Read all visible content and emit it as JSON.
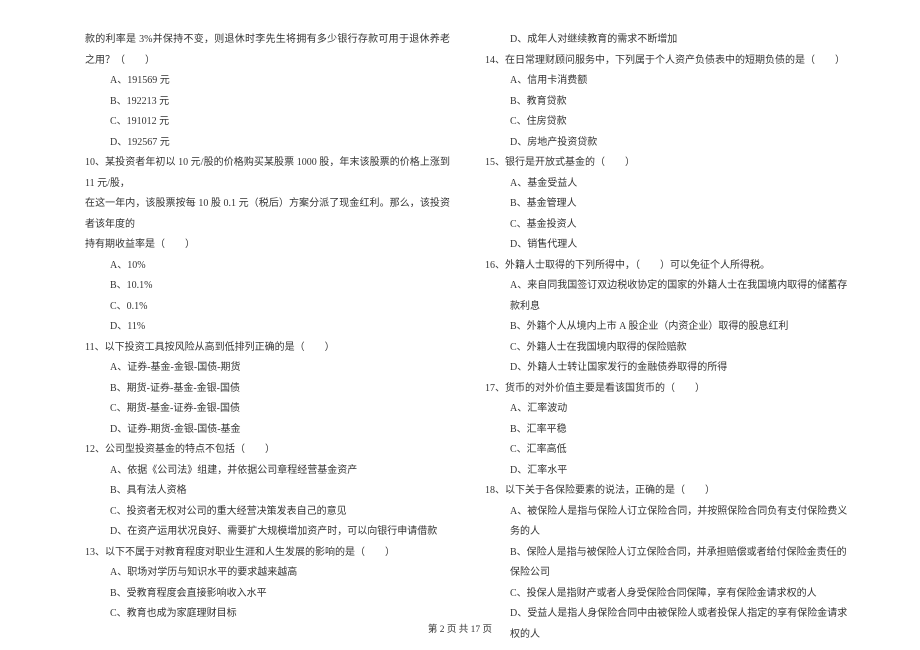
{
  "left": {
    "q9_tail": "款的利率是 3%并保持不变，则退休时李先生将拥有多少银行存款可用于退休养老之用？（　　）",
    "q9_opts": [
      "A、191569 元",
      "B、192213 元",
      "C、191012 元",
      "D、192567 元"
    ],
    "q10_stem_l1": "10、某投资者年初以 10 元/股的价格购买某股票 1000 股，年末该股票的价格上涨到 11 元/股，",
    "q10_stem_l2": "在这一年内，该股票按每 10 股 0.1 元（税后）方案分派了现金红利。那么，该投资者该年度的",
    "q10_stem_l3": "持有期收益率是（　　）",
    "q10_opts": [
      "A、10%",
      "B、10.1%",
      "C、0.1%",
      "D、11%"
    ],
    "q11_stem": "11、以下投资工具按风险从高到低排列正确的是（　　）",
    "q11_opts": [
      "A、证券-基金-金银-国债-期货",
      "B、期货-证券-基金-金银-国债",
      "C、期货-基金-证券-金银-国债",
      "D、证券-期货-金银-国债-基金"
    ],
    "q12_stem": "12、公司型投资基金的特点不包括（　　）",
    "q12_opts": [
      "A、依据《公司法》组建，并依据公司章程经营基金资产",
      "B、具有法人资格",
      "C、投资者无权对公司的重大经营决策发表自己的意见",
      "D、在资产运用状况良好、需要扩大规模增加资产时，可以向银行申请借款"
    ],
    "q13_stem": "13、以下不属于对教育程度对职业生涯和人生发展的影响的是（　　）",
    "q13_opts": [
      "A、职场对学历与知识水平的要求越来越高",
      "B、受教育程度会直接影响收入水平",
      "C、教育也成为家庭理财目标"
    ]
  },
  "right": {
    "q13_optD": "D、成年人对继续教育的需求不断增加",
    "q14_stem": "14、在日常理财顾问服务中，下列属于个人资产负债表中的短期负债的是（　　）",
    "q14_opts": [
      "A、信用卡消费额",
      "B、教育贷款",
      "C、住房贷款",
      "D、房地产投资贷款"
    ],
    "q15_stem": "15、银行是开放式基金的（　　）",
    "q15_opts": [
      "A、基金受益人",
      "B、基金管理人",
      "C、基金投资人",
      "D、销售代理人"
    ],
    "q16_stem": "16、外籍人士取得的下列所得中，（　　）可以免征个人所得税。",
    "q16_opts": [
      "A、来自同我国签订双边税收协定的国家的外籍人士在我国境内取得的储蓄存款利息",
      "B、外籍个人从境内上市 A 股企业（内资企业）取得的股息红利",
      "C、外籍人士在我国境内取得的保险赔款",
      "D、外籍人士转让国家发行的金融债券取得的所得"
    ],
    "q17_stem": "17、货币的对外价值主要是看该国货币的（　　）",
    "q17_opts": [
      "A、汇率波动",
      "B、汇率平稳",
      "C、汇率高低",
      "D、汇率水平"
    ],
    "q18_stem": "18、以下关于各保险要素的说法，正确的是（　　）",
    "q18_opts": [
      "A、被保险人是指与保险人订立保险合同，并按照保险合同负有支付保险费义务的人",
      "B、保险人是指与被保险人订立保险合同，并承担赔偿或者给付保险金责任的保险公司",
      "C、投保人是指财产或者人身受保险合同保障，享有保险金请求权的人",
      "D、受益人是指人身保险合同中由被保险人或者投保人指定的享有保险金请求权的人"
    ]
  },
  "footer": "第 2 页 共 17 页"
}
